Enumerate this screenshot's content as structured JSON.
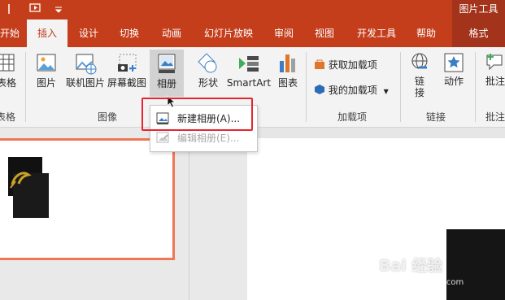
{
  "context_tab_group": "图片工具",
  "tabs": [
    {
      "label": "开始"
    },
    {
      "label": "插入"
    },
    {
      "label": "设计"
    },
    {
      "label": "切换"
    },
    {
      "label": "动画"
    },
    {
      "label": "幻灯片放映"
    },
    {
      "label": "审阅"
    },
    {
      "label": "视图"
    },
    {
      "label": "开发工具"
    },
    {
      "label": "帮助"
    },
    {
      "label": "格式"
    }
  ],
  "active_tab": "插入",
  "ribbon": {
    "table": {
      "label": "表格",
      "group": "表格"
    },
    "images": {
      "picture": "图片",
      "online_picture": "联机图片",
      "screenshot": "屏幕截图",
      "album": "相册",
      "group": "图像"
    },
    "illustrations": {
      "shapes": "形状",
      "smartart": "SmartArt",
      "chart": "图表"
    },
    "addins": {
      "get": "获取加载项",
      "mine": "我的加载项",
      "group": "加载项"
    },
    "links": {
      "link": "链\n接",
      "action": "动作",
      "group": "链接"
    },
    "comments": {
      "comment": "批注",
      "group": "批注"
    }
  },
  "album_menu": {
    "new_album": "新建相册(A)...",
    "edit_album": "编辑相册(E)..."
  },
  "watermark": {
    "brand": "Bai 经验",
    "url": "jingyan.baidu.com"
  },
  "colors": {
    "accent": "#c43e1c",
    "highlight": "#e8242e",
    "thumb_border": "#f07654"
  }
}
